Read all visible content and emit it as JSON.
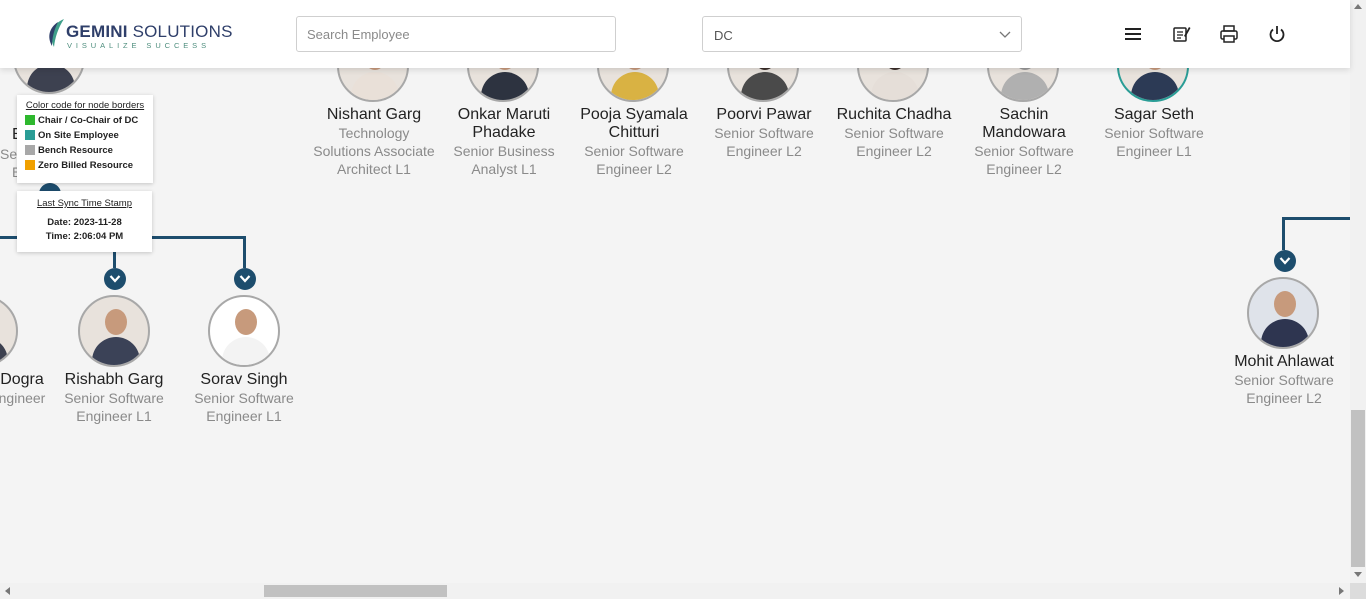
{
  "header": {
    "logo_name_bold": "GEMINI",
    "logo_name_light": " SOLUTIONS",
    "logo_tagline": "VISUALIZE SUCCESS",
    "search_placeholder": "Search Employee",
    "dc_select_value": "DC",
    "icons": [
      "menu-icon",
      "notes-icon",
      "print-icon",
      "power-icon"
    ]
  },
  "legend": {
    "title": "Color code for node borders",
    "items": [
      {
        "label": "Chair / Co-Chair of DC",
        "color": "#2eb82e"
      },
      {
        "label": "On Site Employee",
        "color": "#2a9d96"
      },
      {
        "label": "Bench Resource",
        "color": "#a8a8a8"
      },
      {
        "label": "Zero Billed Resource",
        "color": "#f0a000"
      }
    ]
  },
  "sync": {
    "title": "Last Sync Time Stamp",
    "date": "Date: 2023-11-28",
    "time": "Time: 2:06:04 PM"
  },
  "partial_left_node": {
    "name_part": "E",
    "role_part_1": "Se",
    "role_part_2": "E"
  },
  "top_nodes": [
    {
      "name": "Nishant Garg",
      "role": "Technology Solutions Associate Architect L1"
    },
    {
      "name": "Onkar Maruti Phadake",
      "role": "Senior Business Analyst L1"
    },
    {
      "name": "Pooja Syamala Chitturi",
      "role": "Senior Software Engineer L2"
    },
    {
      "name": "Poorvi Pawar",
      "role": "Senior Software Engineer L2"
    },
    {
      "name": "Ruchita Chadha",
      "role": "Senior Software Engineer L2"
    },
    {
      "name": "Sachin Mandowara",
      "role": "Senior Software Engineer L2"
    },
    {
      "name": "Sagar Seth",
      "role": "Senior Software Engineer L1"
    }
  ],
  "bottom_nodes": [
    {
      "name": "Dogra",
      "role": "ngineer"
    },
    {
      "name": "Rishabh Garg",
      "role": "Senior Software Engineer L1"
    },
    {
      "name": "Sorav Singh",
      "role": "Senior Software Engineer L1"
    },
    {
      "name": "Mohit Ahlawat",
      "role": "Senior Software Engineer L2"
    }
  ]
}
